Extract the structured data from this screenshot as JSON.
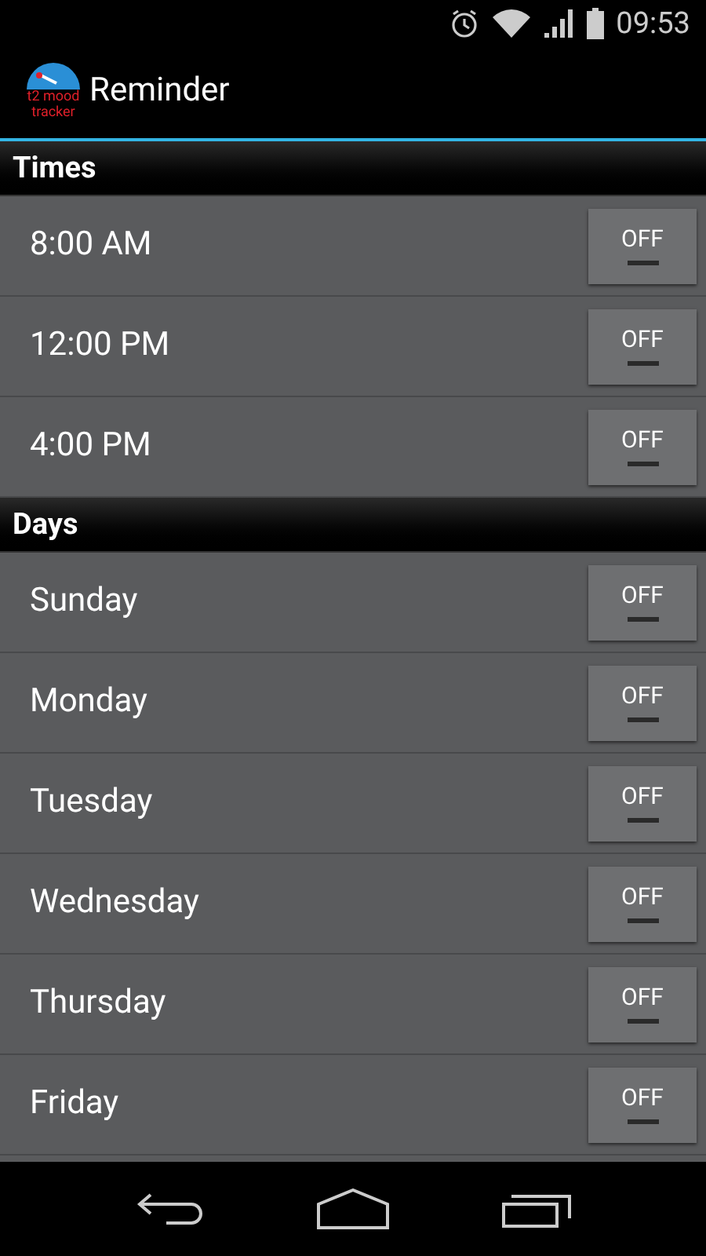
{
  "status_bar": {
    "time": "09:53"
  },
  "app_bar": {
    "logo_text": [
      "t2 mood",
      "tracker"
    ],
    "title": "Reminder"
  },
  "sections": [
    {
      "title": "Times",
      "rows": [
        {
          "label": "8:00 AM",
          "toggle": {
            "text": "OFF",
            "on": false
          }
        },
        {
          "label": "12:00 PM",
          "toggle": {
            "text": "OFF",
            "on": false
          }
        },
        {
          "label": "4:00 PM",
          "toggle": {
            "text": "OFF",
            "on": false
          }
        }
      ]
    },
    {
      "title": "Days",
      "rows": [
        {
          "label": "Sunday",
          "toggle": {
            "text": "OFF",
            "on": false
          }
        },
        {
          "label": "Monday",
          "toggle": {
            "text": "OFF",
            "on": false
          }
        },
        {
          "label": "Tuesday",
          "toggle": {
            "text": "OFF",
            "on": false
          }
        },
        {
          "label": "Wednesday",
          "toggle": {
            "text": "OFF",
            "on": false
          }
        },
        {
          "label": "Thursday",
          "toggle": {
            "text": "OFF",
            "on": false
          }
        },
        {
          "label": "Friday",
          "toggle": {
            "text": "OFF",
            "on": false
          }
        }
      ]
    }
  ]
}
